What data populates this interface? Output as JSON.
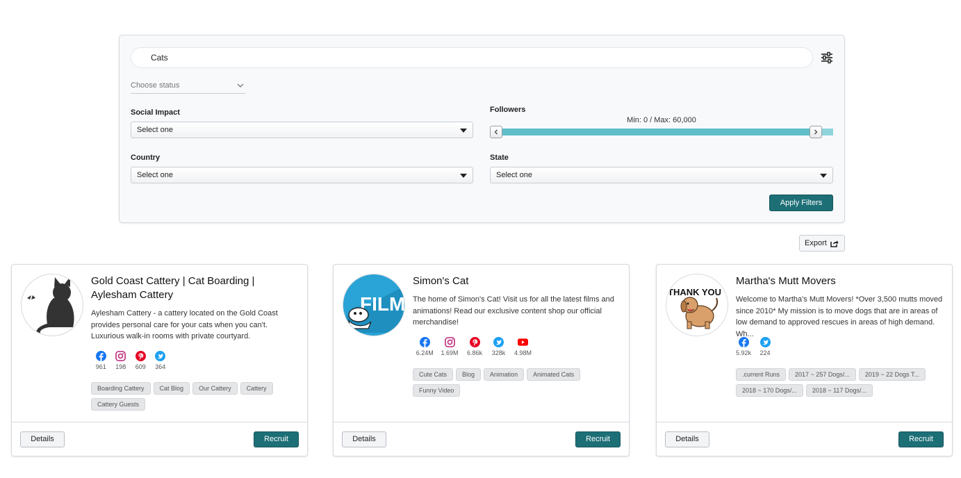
{
  "search": {
    "value": "Cats"
  },
  "filters": {
    "status_placeholder": "Choose status",
    "social_impact": {
      "label": "Social Impact",
      "value": "Select one"
    },
    "followers": {
      "label": "Followers",
      "range_text": "Min: 0 / Max: 60,000",
      "min": 0,
      "max": 60000
    },
    "country": {
      "label": "Country",
      "value": "Select one"
    },
    "state": {
      "label": "State",
      "value": "Select one"
    },
    "apply_label": "Apply Filters"
  },
  "export_label": "Export",
  "cards": [
    {
      "title": "Gold Coast Cattery | Cat Boarding | Aylesham Cattery",
      "description": "Aylesham Cattery - a cattery located on the Gold Coast provides personal care for your cats when you can't. Luxurious walk-in rooms with private courtyard.",
      "socials": [
        {
          "icon": "facebook-icon",
          "count": "961"
        },
        {
          "icon": "instagram-icon",
          "count": "198"
        },
        {
          "icon": "pinterest-icon",
          "count": "609"
        },
        {
          "icon": "twitter-icon",
          "count": "364"
        }
      ],
      "tags": [
        "Boarding Cattery",
        "Cat Blog",
        "Our Cattery",
        "Cattery",
        "Cattery Guests"
      ],
      "details_label": "Details",
      "recruit_label": "Recruit"
    },
    {
      "title": "Simon's Cat",
      "avatar_text": "FILMS",
      "description": "The home of Simon's Cat! Visit us for all the latest films and animations! Read our exclusive content shop our official merchandise!",
      "socials": [
        {
          "icon": "facebook-icon",
          "count": "6.24M"
        },
        {
          "icon": "instagram-icon",
          "count": "1.69M"
        },
        {
          "icon": "pinterest-icon",
          "count": "6.86k"
        },
        {
          "icon": "twitter-icon",
          "count": "328k"
        },
        {
          "icon": "youtube-icon",
          "count": "4.98M"
        }
      ],
      "tags": [
        "Cute Cats",
        "Blog",
        "Animation",
        "Animated Cats",
        "Funny Video"
      ],
      "details_label": "Details",
      "recruit_label": "Recruit"
    },
    {
      "title": "Martha's Mutt Movers",
      "avatar_text": "THANK YOU",
      "description": "Welcome to Martha's Mutt Movers! *Over 3,500 mutts moved since 2010* My mission is to move dogs that are in areas of low demand to approved rescues in areas of high demand. Wh...",
      "socials": [
        {
          "icon": "facebook-icon",
          "count": "5.92k"
        },
        {
          "icon": "twitter-icon",
          "count": "224"
        }
      ],
      "tags": [
        ".current Runs",
        "2017 ~ 257 Dogs/...",
        "2019 ~ 22 Dogs T...",
        "2018 ~ 170 Dogs/...",
        "2018 ~ 117 Dogs/..."
      ],
      "details_label": "Details",
      "recruit_label": "Recruit"
    }
  ],
  "colors": {
    "primary": "#1d6f76",
    "slider": "#5fbec8",
    "facebook": "#1877f2",
    "instagram": "#c13584",
    "pinterest": "#e60023",
    "twitter": "#1da1f2",
    "youtube": "#ff0000"
  }
}
